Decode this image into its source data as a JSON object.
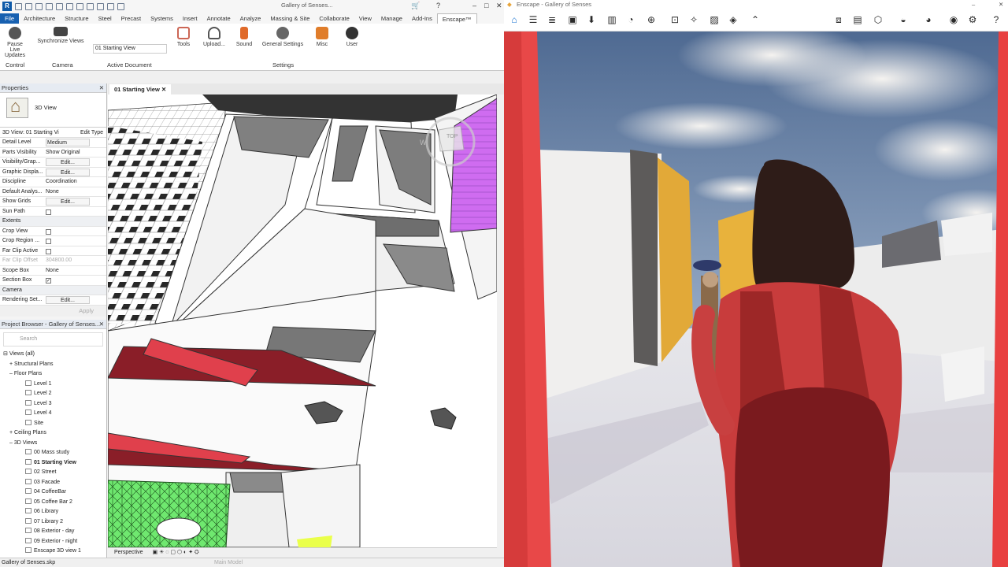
{
  "revit": {
    "title": "Gallery of Senses...",
    "tabs": [
      "File",
      "Architecture",
      "Structure",
      "Steel",
      "Precast",
      "Systems",
      "Insert",
      "Annotate",
      "Analyze",
      "Massing & Site",
      "Collaborate",
      "View",
      "Manage",
      "Add-Ins",
      "Enscape™"
    ],
    "ribbon": {
      "pause_live_updates": "Pause Live Updates",
      "synchronize_views": "Synchronize Views",
      "active_view": "01 Starting View",
      "tools": "Tools",
      "upload": "Upload...",
      "sound": "Sound",
      "general_settings": "General Settings",
      "misc": "Misc",
      "user": "User",
      "panels": {
        "control": "Control",
        "camera": "Camera",
        "active_document": "Active Document",
        "settings": "Settings"
      }
    },
    "properties": {
      "header": "Properties",
      "type": "3D View",
      "selector": "3D View: 01 Starting Vi",
      "edit_type": "Edit Type",
      "rows": [
        {
          "k": "Detail Level",
          "v": "Medium"
        },
        {
          "k": "Parts Visibility",
          "v": "Show Original"
        },
        {
          "k": "Visibility/Grap...",
          "v": "Edit..."
        },
        {
          "k": "Graphic Displa...",
          "v": "Edit..."
        },
        {
          "k": "Discipline",
          "v": "Coordination"
        },
        {
          "k": "Default Analys...",
          "v": "None"
        },
        {
          "k": "Show Grids",
          "v": "Edit..."
        },
        {
          "k": "Sun Path",
          "v": ""
        }
      ],
      "extents_label": "Extents",
      "extents_rows": [
        {
          "k": "Crop View",
          "v": ""
        },
        {
          "k": "Crop Region ...",
          "v": ""
        },
        {
          "k": "Far Clip Active",
          "v": ""
        },
        {
          "k": "Far Clip Offset",
          "v": "304800.00"
        },
        {
          "k": "Scope Box",
          "v": "None"
        },
        {
          "k": "Section Box",
          "v": "✓"
        }
      ],
      "camera_label": "Camera",
      "camera_rows": [
        {
          "k": "Rendering Set...",
          "v": "Edit..."
        }
      ],
      "apply": "Apply"
    },
    "browser": {
      "header": "Project Browser - Gallery of Senses...",
      "search_placeholder": "Search",
      "views_all": "Views (all)",
      "structural_plans": "Structural Plans",
      "floor_plans": "Floor Plans",
      "levels": [
        "Level 1",
        "Level 2",
        "Level 3",
        "Level 4",
        "Site"
      ],
      "ceiling_plans": "Ceiling Plans",
      "three_d_views": "3D Views",
      "views": [
        "00 Mass study",
        "01 Starting View",
        "02 Street",
        "03 Facade",
        "04 CoffeeBar",
        "05 Coffee Bar 2",
        "06 Library",
        "07 Library 2",
        "08 Exterior - day",
        "09 Exterior - night",
        "Enscape 3D view 1"
      ]
    },
    "view_tab": "01 Starting View",
    "view_bar": {
      "mode": "Perspective",
      "model": "Main Model"
    },
    "status": "Gallery of Senses.skp",
    "viewcube": {
      "top": "TOP",
      "w": "W"
    }
  },
  "enscape": {
    "title": "Enscape - Gallery of Senses",
    "accent": "#1a73d0"
  }
}
